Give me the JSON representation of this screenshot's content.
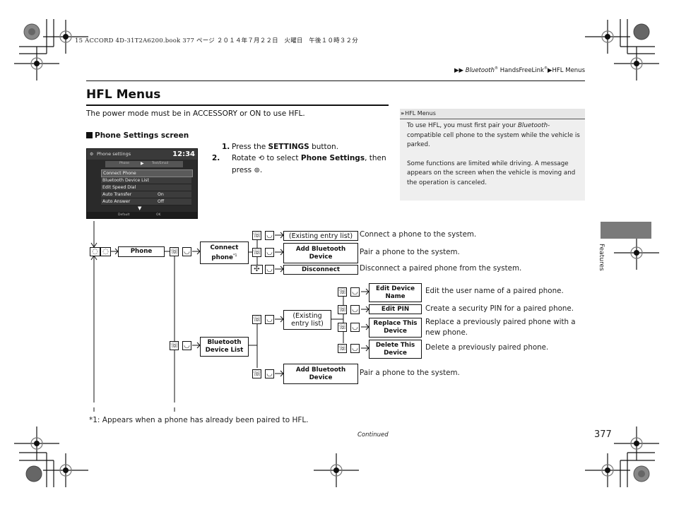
{
  "print_header": "15 ACCORD 4D-31T2A6200.book  377 ページ  ２０１４年７月２２日　火曜日　午後１０時３２分",
  "breadcrumb": {
    "items": [
      "Bluetooth",
      "HandsFreeLink",
      "HFL Menus"
    ],
    "reg_mark": "®"
  },
  "page_title": "HFL Menus",
  "intro_text": "The power mode must be in ACCESSORY or ON to use HFL.",
  "section_heading": "Phone Settings screen",
  "screen": {
    "title": "Phone settings",
    "clock": "12:34",
    "tabs": [
      "Phone",
      "Text/Email"
    ],
    "items": [
      {
        "label": "Connect Phone",
        "value": ""
      },
      {
        "label": "Bluetooth Device List",
        "value": ""
      },
      {
        "label": "Edit Speed Dial",
        "value": ""
      },
      {
        "label": "Auto Transfer",
        "value": "On"
      },
      {
        "label": "Auto Answer",
        "value": "Off"
      }
    ],
    "footer": [
      "Default",
      "OK"
    ]
  },
  "steps": [
    {
      "num": "1.",
      "pre": "Press the ",
      "bold": "SETTINGS",
      "post": " button."
    },
    {
      "num": "2.",
      "pre": "Rotate ",
      "icon": "dial-rotate-icon",
      "mid": " to select ",
      "bold": "Phone Settings",
      "post": ", then press ",
      "icon2": "dial-press-icon",
      "end": "."
    }
  ],
  "side_note": {
    "header": "HFL Menus",
    "paragraph1_a": "To use HFL, you must first pair your ",
    "paragraph1_i": "Bluetooth",
    "paragraph1_b": "-compatible cell phone to the system while the vehicle is parked.",
    "paragraph2": "Some functions are limited while driving. A message appears on the screen when the vehicle is moving and the operation is canceled."
  },
  "diagram": {
    "root_box": "Phone",
    "connect_phone": "Connect phone",
    "connect_phone_sup": "*1",
    "existing_entry_list": "(Existing entry list)",
    "add_bluetooth_device": "Add Bluetooth Device",
    "disconnect": "Disconnect",
    "bluetooth_device_list": "Bluetooth Device List",
    "existing_entry_list_2": "(Existing entry list)",
    "edit_device_name": "Edit Device Name",
    "edit_pin": "Edit PIN",
    "replace_this_device": "Replace This Device",
    "delete_this_device": "Delete This Device",
    "add_bluetooth_device_2": "Add Bluetooth Device",
    "descriptions": {
      "connect": "Connect a phone to the system.",
      "pair": "Pair a phone to the system.",
      "disconnect": "Disconnect a paired phone from the system.",
      "edit_name": "Edit the user name of a paired phone.",
      "edit_pin": "Create a security PIN for a paired phone.",
      "replace": "Replace a previously paired phone with a new phone.",
      "delete": "Delete a previously paired phone.",
      "pair2": "Pair a phone to the system."
    }
  },
  "footnote": "*1: Appears when a phone has already been paired to HFL.",
  "continued": "Continued",
  "side_tab_label": "Features",
  "page_number": "377"
}
